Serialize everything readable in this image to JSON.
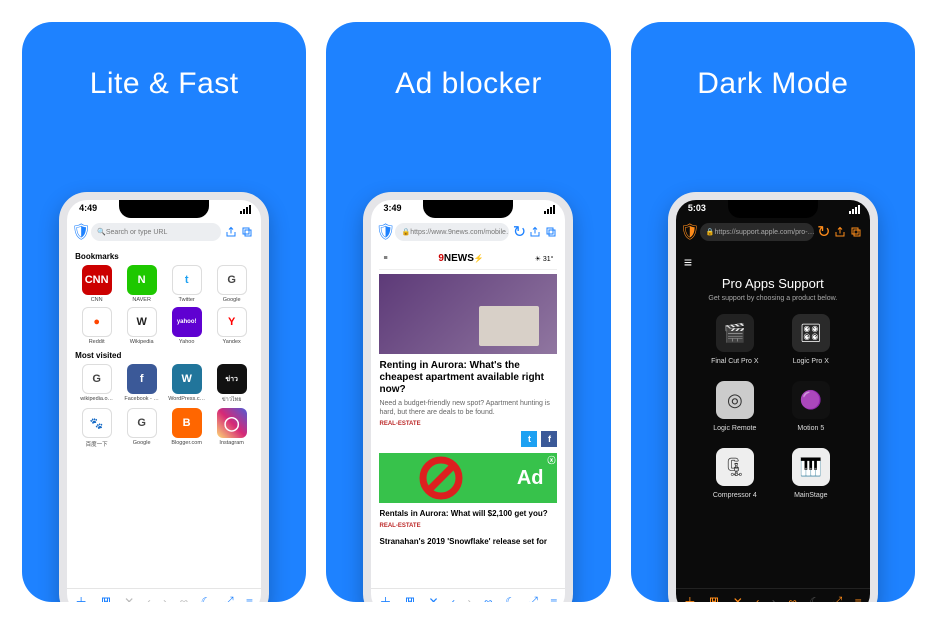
{
  "panel1": {
    "title": "Lite & Fast",
    "time": "4:49",
    "url_placeholder": "Search or type URL",
    "section1": "Bookmarks",
    "section2": "Most visited",
    "bookmarks": [
      {
        "label": "CNN",
        "bg": "#cc0000",
        "txt": "CNN"
      },
      {
        "label": "NAVER",
        "bg": "#1ec800",
        "txt": "N"
      },
      {
        "label": "Twitter",
        "bg": "#ffffff",
        "txt": "t",
        "fg": "#1da1f2",
        "border": true
      },
      {
        "label": "Google",
        "bg": "#ffffff",
        "txt": "G",
        "fg": "#444",
        "border": true
      },
      {
        "label": "Reddit",
        "bg": "#ffffff",
        "txt": "●",
        "fg": "#ff4500",
        "border": true
      },
      {
        "label": "Wikipedia",
        "bg": "#ffffff",
        "txt": "W",
        "fg": "#222",
        "border": true
      },
      {
        "label": "Yahoo",
        "bg": "#5f01d1",
        "txt": "yahoo!",
        "size": "6px"
      },
      {
        "label": "Yandex",
        "bg": "#ffffff",
        "txt": "Y",
        "fg": "#ff0000",
        "border": true
      }
    ],
    "mostvisited": [
      {
        "label": "wikipedia.o…",
        "bg": "#ffffff",
        "txt": "G",
        "fg": "#444",
        "border": true
      },
      {
        "label": "Facebook - …",
        "bg": "#3b5998",
        "txt": "f"
      },
      {
        "label": "WordPress.c…",
        "bg": "#21759b",
        "txt": "W"
      },
      {
        "label": "ข่าวไทย",
        "bg": "#111",
        "txt": "ข่าว",
        "size": "7px"
      },
      {
        "label": "百度一下",
        "bg": "#ffffff",
        "txt": "🐾",
        "fg": "#2529d8",
        "border": true
      },
      {
        "label": "Google",
        "bg": "#ffffff",
        "txt": "G",
        "fg": "#444",
        "border": true
      },
      {
        "label": "Blogger.com",
        "bg": "#ff6600",
        "txt": "B"
      },
      {
        "label": "Instagram",
        "bg": "linear-gradient(45deg,#feda75,#d62976,#4f5bd5)",
        "txt": "◯",
        "size": "14px"
      }
    ]
  },
  "panel2": {
    "title": "Ad blocker",
    "time": "3:49",
    "url": "https://www.9news.com/mobile…",
    "brand": "9NEWS",
    "temp": "31°",
    "headline": "Renting in Aurora: What's the cheapest apartment available right now?",
    "sub": "Need a budget-friendly new spot? Apartment hunting is hard, but there are deals to be found.",
    "tag": "REAL-ESTATE",
    "ad_label": "Ad",
    "item2": "Rentals in Aurora: What will $2,100 get you?",
    "tag2": "REAL-ESTATE",
    "item3": "Stranahan's 2019 'Snowflake' release set for"
  },
  "panel3": {
    "title": "Dark Mode",
    "time": "5:03",
    "url": "https://support.apple.com/pro-…",
    "heading": "Pro Apps Support",
    "sub": "Get support by choosing a product below.",
    "apps": [
      {
        "label": "Final Cut Pro X",
        "bg": "#222",
        "emoji": "🎬"
      },
      {
        "label": "Logic Pro X",
        "bg": "#2a2a2a",
        "emoji": "🎛"
      },
      {
        "label": "Logic Remote",
        "bg": "#ccc",
        "emoji": "◎",
        "fg": "#333"
      },
      {
        "label": "Motion 5",
        "bg": "#111",
        "emoji": "🟣"
      },
      {
        "label": "Compressor 4",
        "bg": "#eee",
        "emoji": "🗜",
        "fg": "#333"
      },
      {
        "label": "MainStage",
        "bg": "#eee",
        "emoji": "🎹",
        "fg": "#333"
      }
    ]
  },
  "toolbar": {
    "plus": "＋",
    "back": "‹",
    "fwd": "›",
    "link": "∞",
    "moon": "☾",
    "expand": "⤢",
    "menu": "≡"
  }
}
